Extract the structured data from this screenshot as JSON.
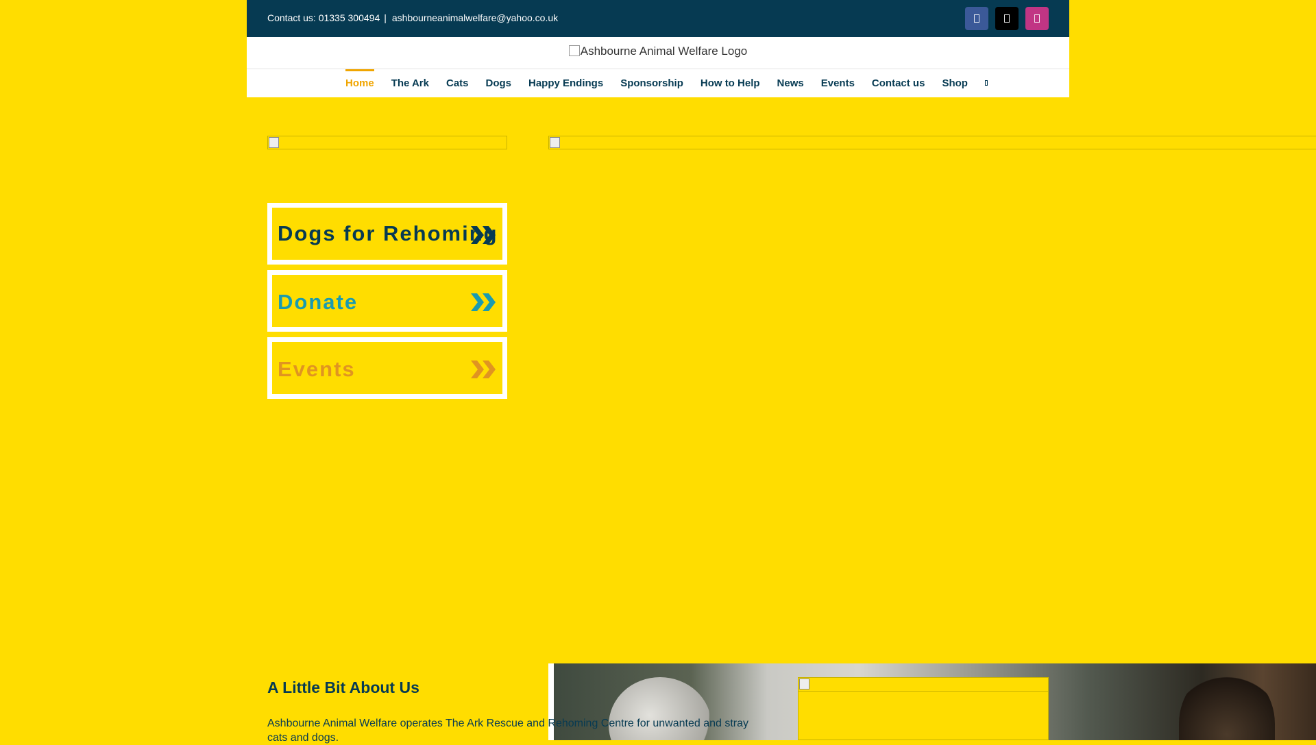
{
  "topbar": {
    "contact_text": "Contact us: 01335 300494",
    "separator": "|",
    "email": "ashbourneanimalwelfare@yahoo.co.uk",
    "social": [
      {
        "icon": "facebook-icon",
        "color": "#3B5998"
      },
      {
        "icon": "x-icon",
        "color": "#000000"
      },
      {
        "icon": "instagram-icon",
        "color": "#C13584"
      }
    ]
  },
  "header": {
    "logo_alt": "Ashbourne Animal Welfare Logo",
    "nav": [
      "Home",
      "The Ark",
      "Cats",
      "Dogs",
      "Happy Endings",
      "Sponsorship",
      "How to Help",
      "News",
      "Events",
      "Contact us",
      "Shop"
    ],
    "active_nav": "Home",
    "search_icon": "search-icon"
  },
  "cta": {
    "dogs": "Dogs for Rehoming",
    "donate": "Donate",
    "events": "Events"
  },
  "about": {
    "title": "A Little Bit About Us",
    "text": "Ashbourne Animal Welfare operates The Ark Rescue and Rehoming Centre for unwanted and stray cats and dogs."
  },
  "colors": {
    "background": "#FFDD00",
    "topbar": "#063A52",
    "accent": "#F0A500",
    "teal": "#1A9BB0",
    "orange": "#E09421"
  }
}
